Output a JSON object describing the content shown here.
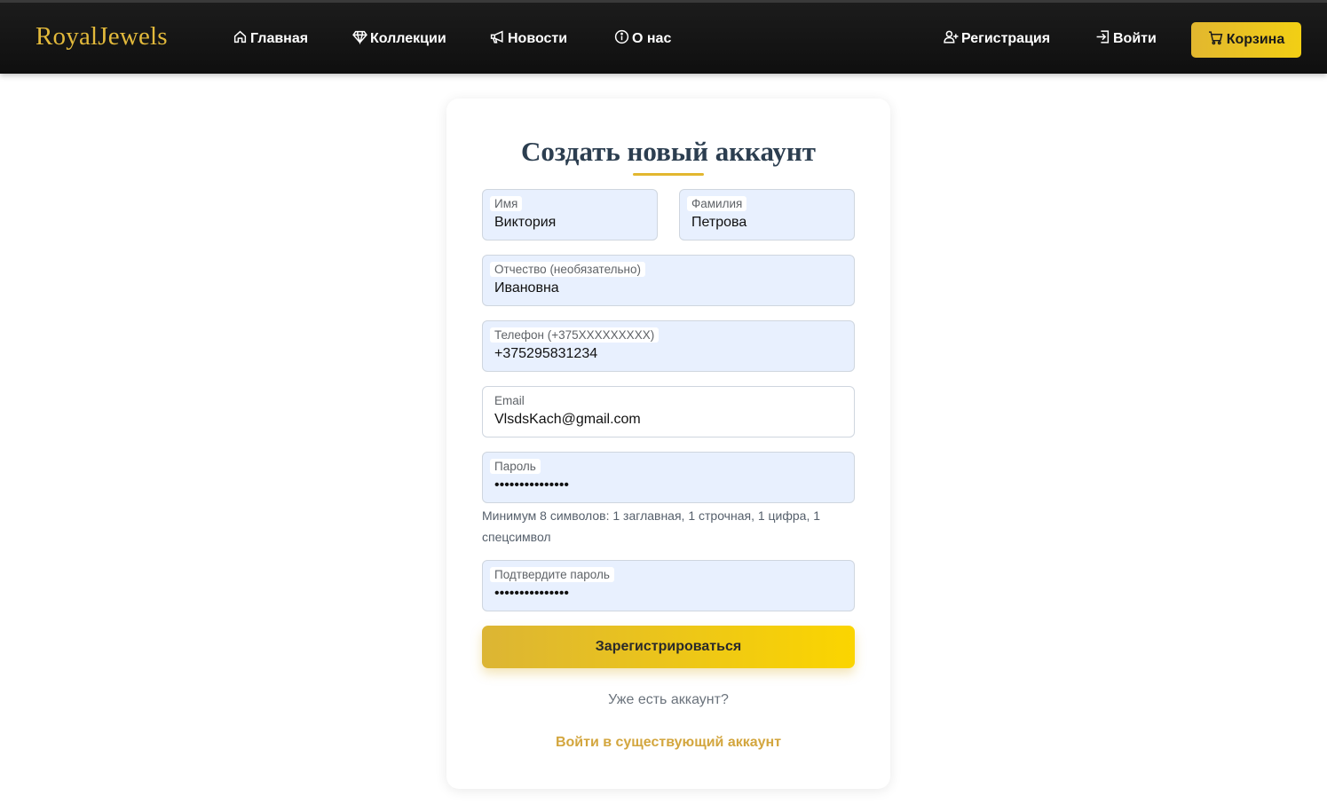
{
  "nav": {
    "brand": "RoyalJewels",
    "links": [
      {
        "label": "Главная",
        "icon": "home-icon"
      },
      {
        "label": "Коллекции",
        "icon": "gem-icon"
      },
      {
        "label": "Новости",
        "icon": "megaphone-icon"
      },
      {
        "label": "О нас",
        "icon": "info-icon"
      }
    ],
    "register": {
      "label": "Регистрация",
      "icon": "user-plus-icon"
    },
    "login": {
      "label": "Войти",
      "icon": "login-icon"
    },
    "cart": {
      "label": "Корзина",
      "icon": "cart-icon"
    }
  },
  "form": {
    "title": "Создать новый аккаунт",
    "fields": {
      "first_name": {
        "label": "Имя",
        "value": "Виктория"
      },
      "last_name": {
        "label": "Фамилия",
        "value": "Петрова"
      },
      "patronymic": {
        "label": "Отчество (необязательно)",
        "value": "Ивановна"
      },
      "phone": {
        "label": "Телефон (+375XXXXXXXXX)",
        "value": "+375295831234"
      },
      "email": {
        "label": "Email",
        "value": "VlsdsKach@gmail.com"
      },
      "password": {
        "label": "Пароль",
        "value": "•••••••••••••••"
      },
      "password_confirm": {
        "label": "Подтвердите пароль",
        "value": "•••••••••••••••"
      }
    },
    "password_hint": "Минимум 8 символов: 1 заглавная, 1 строчная, 1 цифра, 1 спецсимвол",
    "submit_label": "Зарегистрироваться",
    "have_account": "Уже есть аккаунт?",
    "login_link": "Войти в существующий аккаунт"
  },
  "colors": {
    "accent": "#e2b72f",
    "navbar": "#111111",
    "field_autofill": "#e8f0fe",
    "title": "#2c3e50",
    "link": "#d3a63e"
  }
}
